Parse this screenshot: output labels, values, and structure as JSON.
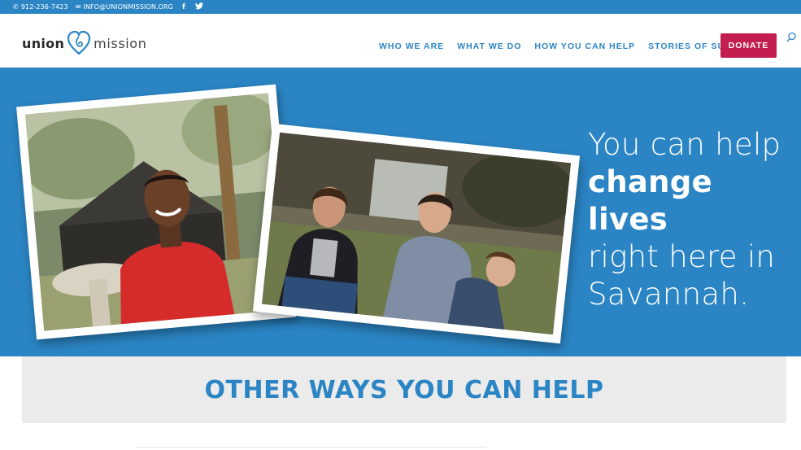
{
  "topbar": {
    "phone": "912-236-7423",
    "email": "INFO@UNIONMISSION.ORG",
    "icons": [
      "phone-icon",
      "mail-icon",
      "facebook-icon",
      "twitter-icon"
    ]
  },
  "logo": {
    "word1": "union",
    "word2": "mission"
  },
  "nav": {
    "items": [
      "WHO WE ARE",
      "WHAT WE DO",
      "HOW YOU CAN HELP",
      "STORIES OF SUCCESS"
    ],
    "donate": "DONATE"
  },
  "hero": {
    "line1": "You can help",
    "line2": "change lives",
    "line3": "right here in",
    "line4": "Savannah."
  },
  "section": {
    "title": "OTHER WAYS YOU CAN HELP"
  },
  "colors": {
    "brand_blue": "#2b85c4",
    "donate_red": "#c41d50",
    "section_bg": "#ebebeb"
  }
}
